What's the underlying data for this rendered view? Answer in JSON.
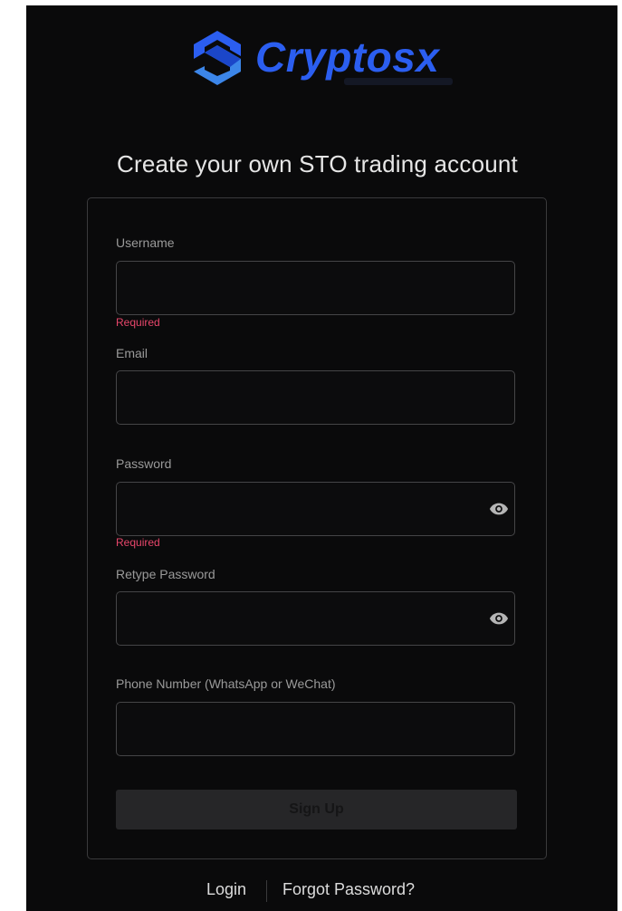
{
  "brand": {
    "name": "Cryptosx",
    "logo_icon": "cryptosx-logo-icon",
    "accent": "#2b5ef0"
  },
  "heading": "Create your own STO trading account",
  "form": {
    "username": {
      "label": "Username",
      "value": "",
      "error": "Required"
    },
    "email": {
      "label": "Email",
      "value": ""
    },
    "password": {
      "label": "Password",
      "value": "",
      "error": "Required",
      "icon": "eye-icon"
    },
    "retype_password": {
      "label": "Retype Password",
      "value": "",
      "icon": "eye-icon"
    },
    "phone": {
      "label": "Phone Number (WhatsApp or WeChat)",
      "value": ""
    },
    "submit_label": "Sign Up",
    "error_color": "#e8466b"
  },
  "footer": {
    "login_label": "Login",
    "forgot_label": "Forgot Password?"
  }
}
